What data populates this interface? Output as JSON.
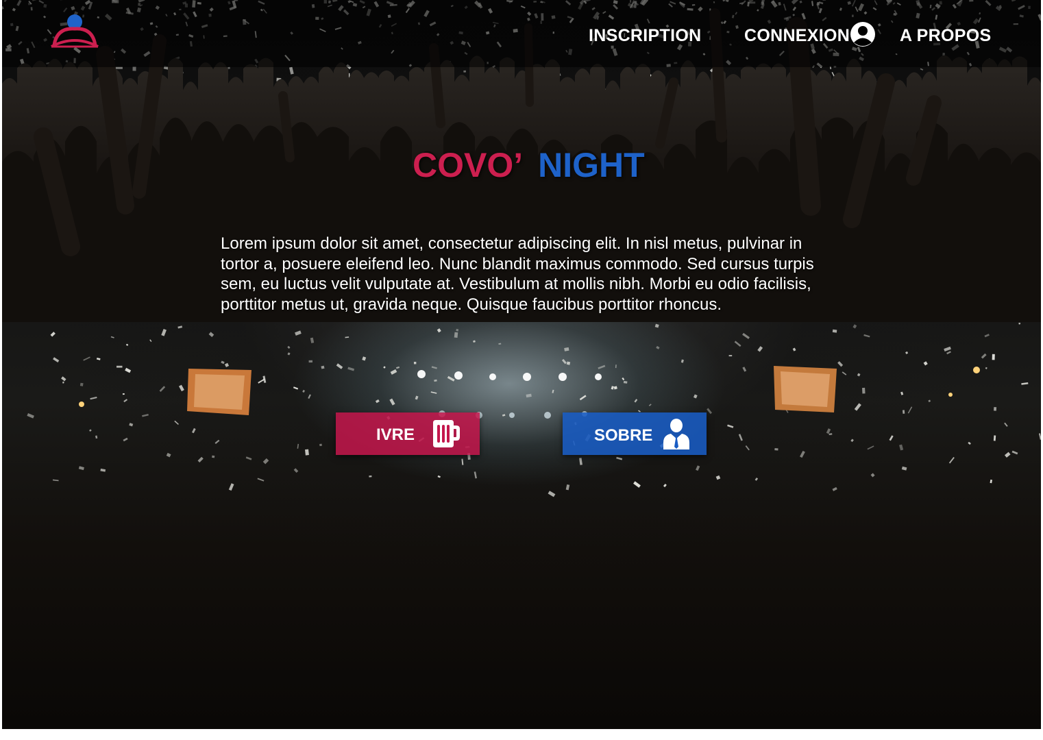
{
  "header": {
    "logo_name": "covo-night-logo",
    "nav": {
      "inscription": "INSCRIPTION",
      "connexion": "CONNEXION",
      "apropos": "A PROPOS"
    },
    "user_icon": "user-circle-icon"
  },
  "hero": {
    "title_part1": "COVO’",
    "title_part2": "NIGHT",
    "description": "Lorem ipsum dolor sit amet, consectetur adipiscing elit. In nisl metus, pulvinar in tortor a, posuere eleifend leo. Nunc blandit maximus commodo. Sed cursus turpis sem, eu luctus velit vulputate at. Vestibulum at mollis nibh. Morbi eu odio facilisis, porttitor metus ut, gravida neque. Quisque faucibus porttitor rhoncus.",
    "background_image": "concert-crowd-confetti-photo"
  },
  "buttons": {
    "ivre": {
      "label": "IVRE",
      "icon": "beer-mug-icon",
      "color": "#c4164c"
    },
    "sobre": {
      "label": "SOBRE",
      "icon": "businessman-icon",
      "color": "#195cc4"
    }
  },
  "colors": {
    "accent_red": "#cc1f4f",
    "accent_blue": "#1e62c9",
    "header_bg": "#000000"
  }
}
